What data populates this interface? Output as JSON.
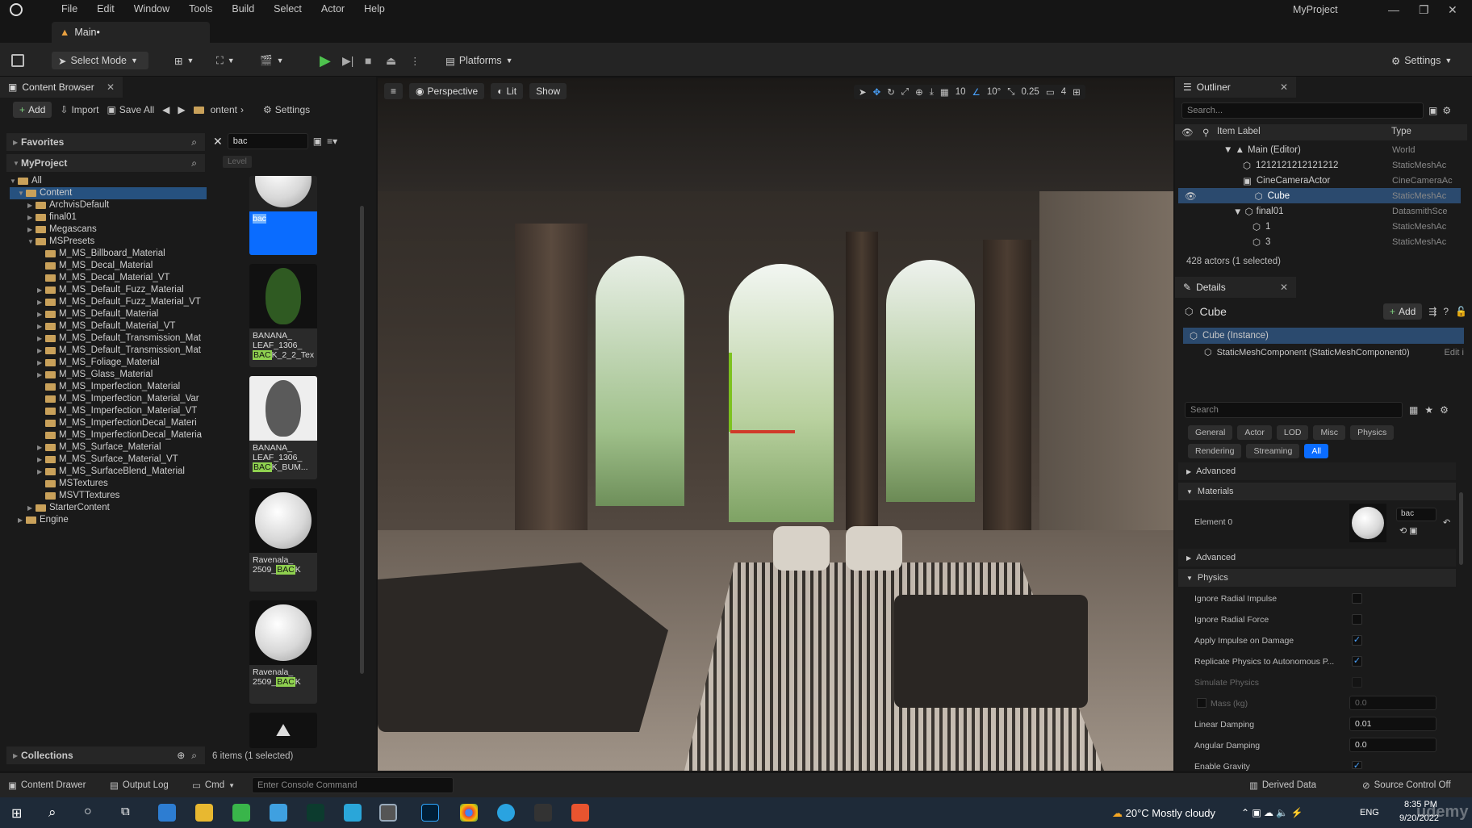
{
  "menu": [
    "File",
    "Edit",
    "Window",
    "Tools",
    "Build",
    "Select",
    "Actor",
    "Help"
  ],
  "project_name": "MyProject",
  "doc_tab": "Main•",
  "toolbar": {
    "select_mode": "Select Mode",
    "platforms": "Platforms",
    "settings": "Settings"
  },
  "content_browser": {
    "tab": "Content Browser",
    "add": "Add",
    "import": "Import",
    "save_all": "Save All",
    "path": "ontent",
    "settings": "Settings",
    "favorites": "Favorites",
    "project": "MyProject",
    "search_value": "bac",
    "filter_chip": "Level",
    "tree": [
      "All",
      "Content",
      "ArchvisDefault",
      "final01",
      "Megascans",
      "MSPresets",
      "M_MS_Billboard_Material",
      "M_MS_Decal_Material",
      "M_MS_Decal_Material_VT",
      "M_MS_Default_Fuzz_Material",
      "M_MS_Default_Fuzz_Material_VT",
      "M_MS_Default_Material",
      "M_MS_Default_Material_VT",
      "M_MS_Default_Transmission_Mat",
      "M_MS_Default_Transmission_Mat",
      "M_MS_Foliage_Material",
      "M_MS_Glass_Material",
      "M_MS_Imperfection_Material",
      "M_MS_Imperfection_Material_Var",
      "M_MS_Imperfection_Material_VT",
      "M_MS_ImperfectionDecal_Materi",
      "M_MS_ImperfectionDecal_Materia",
      "M_MS_Surface_Material",
      "M_MS_Surface_Material_VT",
      "M_MS_SurfaceBlend_Material",
      "MSTextures",
      "MSVTTextures",
      "StarterContent",
      "Engine"
    ],
    "assets": [
      {
        "line1": "bac",
        "line2": "",
        "line3": ""
      },
      {
        "line1": "BANANA_",
        "line2": "LEAF_1306_",
        "line3": "BAC",
        "line3b": "K_2_2_Tex"
      },
      {
        "line1": "BANANA_",
        "line2": "LEAF_1306_",
        "line3": "BAC",
        "line3b": "K_BUM..."
      },
      {
        "line1": "Ravenala_",
        "line2": "2509_",
        "line3": "BAC",
        "line3b": "K"
      },
      {
        "line1": "Ravenala_",
        "line2": "2509_",
        "line3": "BAC",
        "line3b": "K"
      }
    ],
    "collections": "Collections",
    "status": "6 items (1 selected)"
  },
  "viewport": {
    "perspective": "Perspective",
    "lit": "Lit",
    "show": "Show",
    "grid": "10",
    "angle": "10°",
    "scale": "0.25",
    "camera": "4"
  },
  "outliner": {
    "tab": "Outliner",
    "search_placeholder": "Search...",
    "col_label": "Item Label",
    "col_type": "Type",
    "rows": [
      {
        "label": "Main (Editor)",
        "type": "World"
      },
      {
        "label": "1212121212121212",
        "type": "StaticMeshAc"
      },
      {
        "label": "CineCameraActor",
        "type": "CineCameraAc"
      },
      {
        "label": "Cube",
        "type": "StaticMeshAc"
      },
      {
        "label": "final01",
        "type": "DatasmithSce"
      },
      {
        "label": "1",
        "type": "StaticMeshAc"
      },
      {
        "label": "3",
        "type": "StaticMeshAc"
      }
    ],
    "status": "428 actors (1 selected)"
  },
  "details": {
    "tab": "Details",
    "object": "Cube",
    "add": "Add",
    "instance": "Cube (Instance)",
    "component": "StaticMeshComponent (StaticMeshComponent0)",
    "edit": "Edit i",
    "search_placeholder": "Search",
    "tabs": [
      "General",
      "Actor",
      "LOD",
      "Misc",
      "Physics",
      "Rendering",
      "Streaming",
      "All"
    ],
    "advanced": "Advanced",
    "materials": "Materials",
    "element0": "Element 0",
    "mat_name": "bac",
    "physics": "Physics",
    "props": [
      {
        "label": "Ignore Radial Impulse",
        "checked": false
      },
      {
        "label": "Ignore Radial Force",
        "checked": false
      },
      {
        "label": "Apply Impulse on Damage",
        "checked": true
      },
      {
        "label": "Replicate Physics to Autonomous P...",
        "checked": true
      },
      {
        "label": "Simulate Physics",
        "checked": false
      }
    ],
    "mass_label": "Mass (kg)",
    "mass_value": "0.0",
    "linear_label": "Linear Damping",
    "linear_value": "0.01",
    "angular_label": "Angular Damping",
    "angular_value": "0.0",
    "gravity_label": "Enable Gravity"
  },
  "bottom": {
    "drawer": "Content Drawer",
    "output": "Output Log",
    "cmd": "Cmd",
    "console": "Enter Console Command",
    "derived": "Derived Data",
    "source": "Source Control Off"
  },
  "taskbar": {
    "weather": "20°C  Mostly cloudy",
    "lang": "ENG",
    "time": "8:35 PM",
    "date": "9/20/2022",
    "watermark": "udemy"
  }
}
